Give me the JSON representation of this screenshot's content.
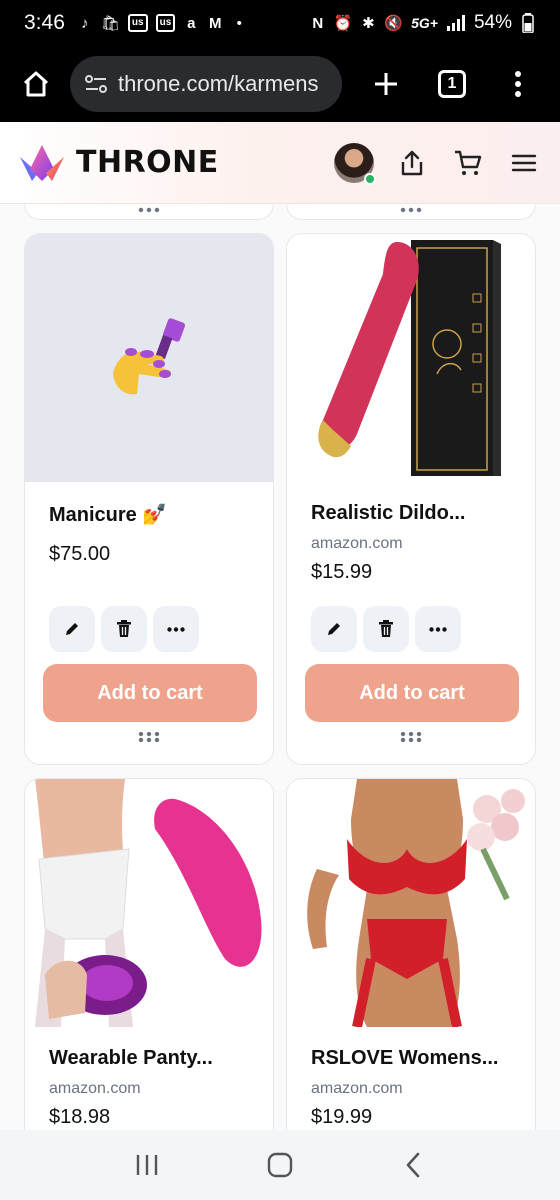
{
  "status": {
    "time": "3:46",
    "left_icons": [
      "tiktok-icon",
      "shopping-bag-icon",
      "us",
      "us",
      "airbnb-icon",
      "gmail-icon",
      "dot"
    ],
    "right_icons": [
      "nfc-icon",
      "alarm-icon",
      "bluetooth-icon",
      "mute-icon",
      "5g-icon",
      "signal-icon"
    ],
    "network": "5G+",
    "battery": "54%"
  },
  "browser": {
    "url": "throne.com/karmens",
    "tab_count": "1"
  },
  "site": {
    "brand": "THRONE",
    "accent": "#f0a38c"
  },
  "products": [
    {
      "title": "Manicure 💅",
      "source": "",
      "price": "$75.00",
      "image": "nail-polish-emoji",
      "cart_label": "Add to cart"
    },
    {
      "title": "Realistic Dildo...",
      "source": "amazon.com",
      "price": "$15.99",
      "image": "product-photo",
      "cart_label": "Add to cart"
    },
    {
      "title": "Wearable Panty...",
      "source": "amazon.com",
      "price": "$18.98",
      "image": "product-photo"
    },
    {
      "title": "RSLOVE Womens...",
      "source": "amazon.com",
      "price": "$19.99",
      "image": "product-photo"
    }
  ]
}
